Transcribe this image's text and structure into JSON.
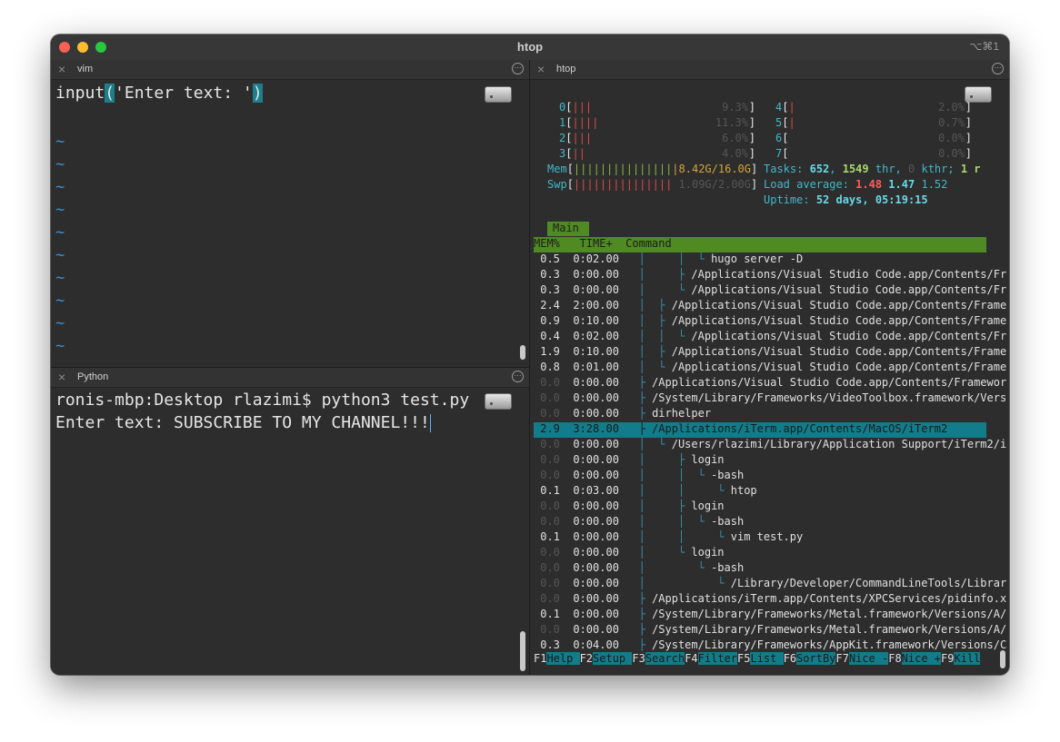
{
  "window": {
    "title": "htop",
    "shortcut": "⌥⌘1"
  },
  "panes": {
    "vim": {
      "title": "vim",
      "close": "×",
      "line": [
        "input",
        "(",
        "'Enter text: '",
        ")"
      ],
      "tilde": "~"
    },
    "python": {
      "title": "Python",
      "close": "×",
      "line1": "ronis-mbp:Desktop rlazimi$ python3 test.py",
      "line2": "Enter text: SUBSCRIBE TO MY CHANNEL!!!"
    },
    "htop": {
      "title": "htop",
      "close": "×",
      "cpus": [
        {
          "id": "0",
          "bars": "|||",
          "pct": "9.3%"
        },
        {
          "id": "1",
          "bars": "||||",
          "pct": "11.3%"
        },
        {
          "id": "2",
          "bars": "|||",
          "pct": "6.0%"
        },
        {
          "id": "3",
          "bars": "||",
          "pct": "4.0%"
        },
        {
          "id": "4",
          "bars": "|",
          "pct": "2.0%"
        },
        {
          "id": "5",
          "bars": "|",
          "pct": "0.7%"
        },
        {
          "id": "6",
          "bars": "",
          "pct": "0.0%"
        },
        {
          "id": "7",
          "bars": "",
          "pct": "0.0%"
        }
      ],
      "mem": {
        "label": "Mem",
        "bars": "|||||||||||||||",
        "value": "8.42G/16.0G"
      },
      "swp": {
        "label": "Swp",
        "bars": "|||||||||||||||",
        "value": "1.09G/2.00G"
      },
      "tasks": {
        "label": "Tasks:",
        "tasks": "652",
        "thr": "1549",
        "thr_label": "thr,",
        "kthr": "0",
        "kthr_label": "kthr;",
        "running": "1 r"
      },
      "load": {
        "label": "Load average:",
        "l1": "1.48",
        "l5": "1.47",
        "l15": "1.52"
      },
      "uptime": {
        "label": "Uptime:",
        "value": "52 days, 05:19:15"
      },
      "tab": "Main",
      "header": "MEM%   TIME+  Command",
      "processes": [
        {
          "mem": "0.5",
          "time": "0:02.00",
          "tree": "  │     │  └ ",
          "cmd": "hugo server -D"
        },
        {
          "mem": "0.3",
          "time": "0:00.00",
          "tree": "  │     ├ ",
          "cmd": "/Applications/Visual Studio Code.app/Contents/Fr"
        },
        {
          "mem": "0.3",
          "time": "0:00.00",
          "tree": "  │     └ ",
          "cmd": "/Applications/Visual Studio Code.app/Contents/Fr"
        },
        {
          "mem": "2.4",
          "time": "2:00.00",
          "tree": "  │  ├ ",
          "cmd": "/Applications/Visual Studio Code.app/Contents/Frame"
        },
        {
          "mem": "0.9",
          "time": "0:10.00",
          "tree": "  │  ├ ",
          "cmd": "/Applications/Visual Studio Code.app/Contents/Frame"
        },
        {
          "mem": "0.4",
          "time": "0:02.00",
          "tree": "  │  │  └ ",
          "cmd": "/Applications/Visual Studio Code.app/Contents/Fr"
        },
        {
          "mem": "1.9",
          "time": "0:10.00",
          "tree": "  │  ├ ",
          "cmd": "/Applications/Visual Studio Code.app/Contents/Frame"
        },
        {
          "mem": "0.8",
          "time": "0:01.00",
          "tree": "  │  └ ",
          "cmd": "/Applications/Visual Studio Code.app/Contents/Frame"
        },
        {
          "mem": "0.0",
          "time": "0:00.00",
          "tree": "  ├ ",
          "cmd": "/Applications/Visual Studio Code.app/Contents/Framewor"
        },
        {
          "mem": "0.0",
          "time": "0:00.00",
          "tree": "  ├ ",
          "cmd": "/System/Library/Frameworks/VideoToolbox.framework/Vers"
        },
        {
          "mem": "0.0",
          "time": "0:00.00",
          "tree": "  ├ ",
          "cmd": "dirhelper"
        },
        {
          "mem": "2.9",
          "time": "3:28.00",
          "tree": "  ├ ",
          "cmd": "/Applications/iTerm.app/Contents/MacOS/iTerm2",
          "selected": true
        },
        {
          "mem": "0.0",
          "time": "0:00.00",
          "tree": "  │  └ ",
          "cmd": "/Users/rlazimi/Library/Application Support/iTerm2/i"
        },
        {
          "mem": "0.0",
          "time": "0:00.00",
          "tree": "  │     ├ ",
          "cmd": "login"
        },
        {
          "mem": "0.0",
          "time": "0:00.00",
          "tree": "  │     │  └ ",
          "cmd": "-bash"
        },
        {
          "mem": "0.1",
          "time": "0:03.00",
          "tree": "  │     │     └ ",
          "cmd": "htop"
        },
        {
          "mem": "0.0",
          "time": "0:00.00",
          "tree": "  │     ├ ",
          "cmd": "login"
        },
        {
          "mem": "0.0",
          "time": "0:00.00",
          "tree": "  │     │  └ ",
          "cmd": "-bash"
        },
        {
          "mem": "0.1",
          "time": "0:00.00",
          "tree": "  │     │     └ ",
          "cmd": "vim test.py"
        },
        {
          "mem": "0.0",
          "time": "0:00.00",
          "tree": "  │     └ ",
          "cmd": "login"
        },
        {
          "mem": "0.0",
          "time": "0:00.00",
          "tree": "  │        └ ",
          "cmd": "-bash"
        },
        {
          "mem": "0.0",
          "time": "0:00.00",
          "tree": "  │           └ ",
          "cmd": "/Library/Developer/CommandLineTools/Librar"
        },
        {
          "mem": "0.0",
          "time": "0:00.00",
          "tree": "  ├ ",
          "cmd": "/Applications/iTerm.app/Contents/XPCServices/pidinfo.x"
        },
        {
          "mem": "0.1",
          "time": "0:00.00",
          "tree": "  ├ ",
          "cmd": "/System/Library/Frameworks/Metal.framework/Versions/A/"
        },
        {
          "mem": "0.0",
          "time": "0:00.00",
          "tree": "  ├ ",
          "cmd": "/System/Library/Frameworks/Metal.framework/Versions/A/"
        },
        {
          "mem": "0.3",
          "time": "0:04.00",
          "tree": "  ├ ",
          "cmd": "/System/Library/Frameworks/AppKit.framework/Versions/C"
        }
      ],
      "fkeys": [
        {
          "key": "F1",
          "label": "Help  "
        },
        {
          "key": "F2",
          "label": "Setup "
        },
        {
          "key": "F3",
          "label": "Search"
        },
        {
          "key": "F4",
          "label": "Filter"
        },
        {
          "key": "F5",
          "label": "List  "
        },
        {
          "key": "F6",
          "label": "SortBy"
        },
        {
          "key": "F7",
          "label": "Nice -"
        },
        {
          "key": "F8",
          "label": "Nice +"
        },
        {
          "key": "F9",
          "label": "Kill"
        }
      ]
    }
  }
}
